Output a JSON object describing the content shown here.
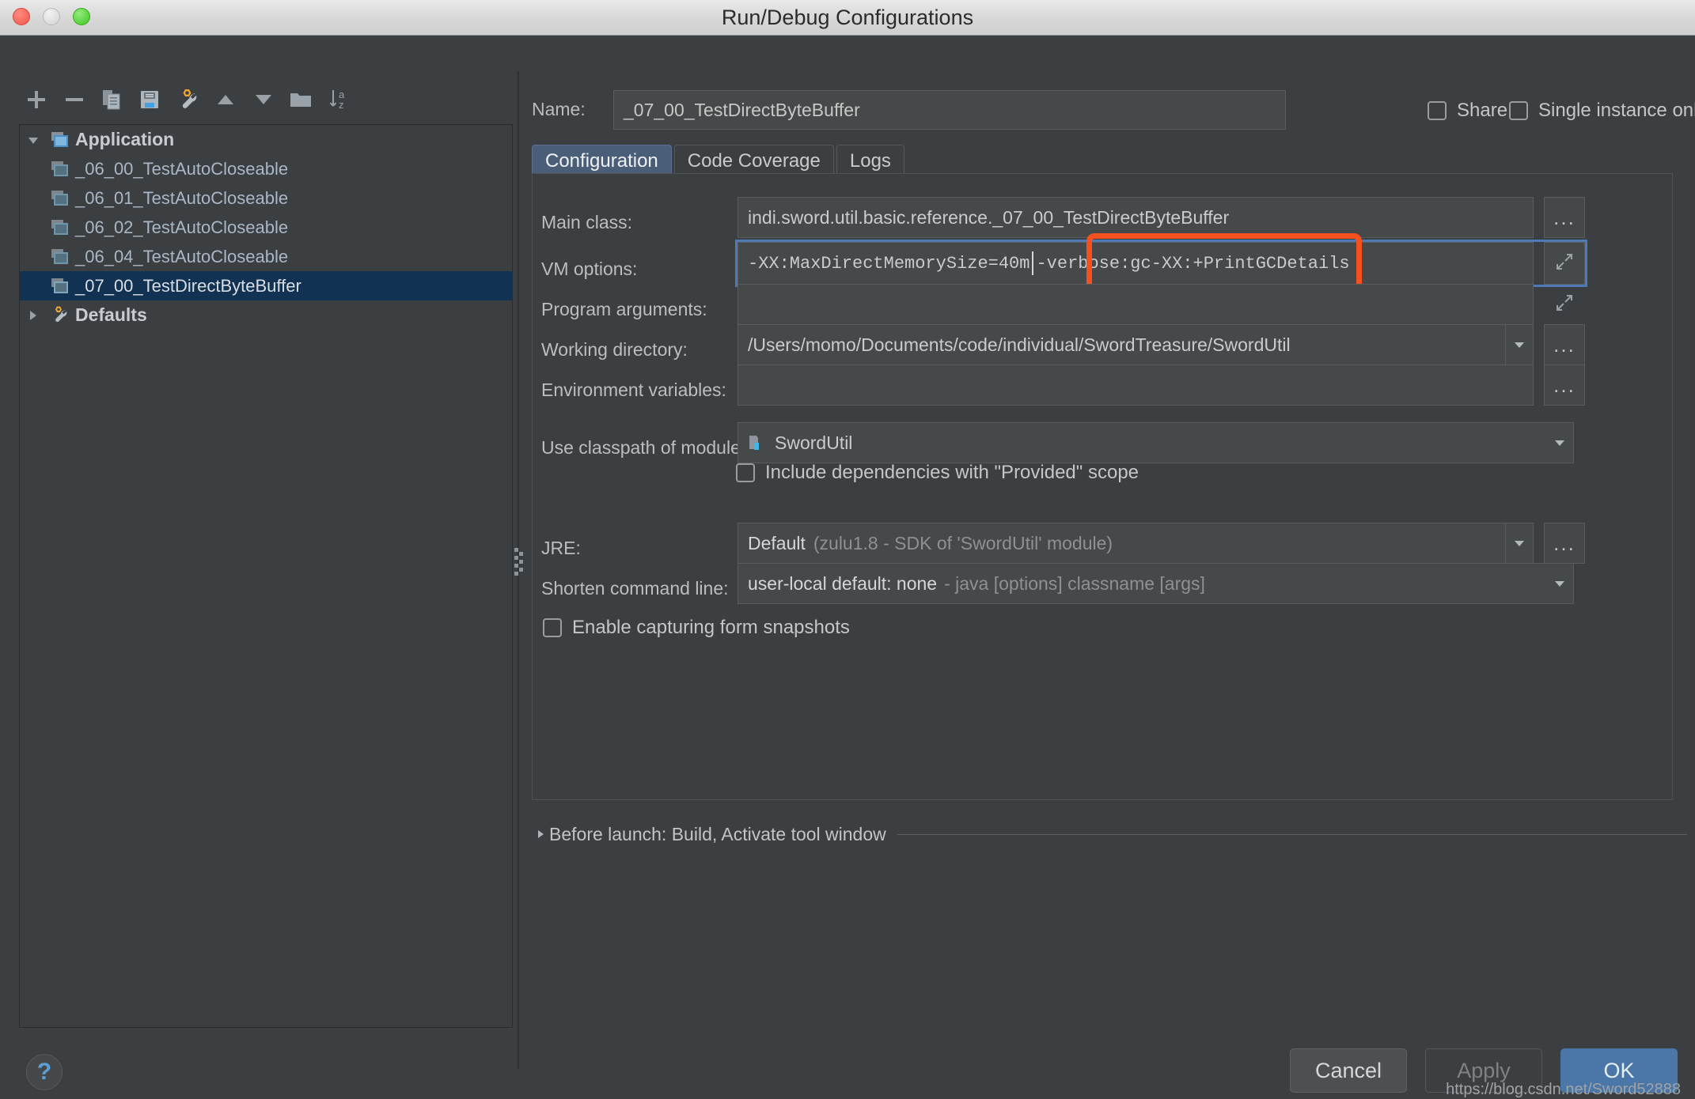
{
  "window": {
    "title": "Run/Debug Configurations",
    "traffic_lights": [
      "close",
      "minimize",
      "maximize"
    ]
  },
  "toolbar": {
    "items": [
      {
        "name": "add-icon",
        "glyph": "+"
      },
      {
        "name": "remove-icon",
        "glyph": "-"
      },
      {
        "name": "copy-icon",
        "glyph": "copy"
      },
      {
        "name": "save-icon",
        "glyph": "save"
      },
      {
        "name": "edit-defaults-icon",
        "glyph": "wrench"
      },
      {
        "name": "move-up-icon",
        "glyph": "triangle-up"
      },
      {
        "name": "move-down-icon",
        "glyph": "triangle-down"
      },
      {
        "name": "new-folder-icon",
        "glyph": "folder"
      },
      {
        "name": "sort-alphabetically-icon",
        "glyph": "sort-az"
      }
    ]
  },
  "tree": {
    "nodes": [
      {
        "label": "Application",
        "level": 0,
        "expanded": true,
        "selected": false,
        "icon": "application-icon"
      },
      {
        "label": "_06_00_TestAutoCloseable",
        "level": 1,
        "expanded": null,
        "selected": false,
        "icon": "run-config-icon"
      },
      {
        "label": "_06_01_TestAutoCloseable",
        "level": 1,
        "expanded": null,
        "selected": false,
        "icon": "run-config-icon"
      },
      {
        "label": "_06_02_TestAutoCloseable",
        "level": 1,
        "expanded": null,
        "selected": false,
        "icon": "run-config-icon"
      },
      {
        "label": "_06_04_TestAutoCloseable",
        "level": 1,
        "expanded": null,
        "selected": false,
        "icon": "run-config-icon"
      },
      {
        "label": "_07_00_TestDirectByteBuffer",
        "level": 1,
        "expanded": null,
        "selected": true,
        "icon": "run-config-icon"
      },
      {
        "label": "Defaults",
        "level": 0,
        "expanded": false,
        "selected": false,
        "icon": "defaults-wrench-icon"
      }
    ]
  },
  "form": {
    "name_label": "Name:",
    "name_value": "_07_00_TestDirectByteBuffer",
    "share_label": "Share",
    "share_checked": false,
    "single_instance_label": "Single instance only",
    "single_instance_checked": false,
    "tabs": [
      {
        "label": "Configuration",
        "active": true
      },
      {
        "label": "Code Coverage",
        "active": false
      },
      {
        "label": "Logs",
        "active": false
      }
    ],
    "main_class_label": "Main class:",
    "main_class_value": "indi.sword.util.basic.reference._07_00_TestDirectByteBuffer",
    "vm_options_label": "VM options:",
    "vm_options_value": "-XX:MaxDirectMemorySize=40m -verbose:gc -XX:+PrintGCDetails",
    "vm_options_part1": "-XX:MaxDirectMemorySize=40m ",
    "vm_options_part2": "-verbose:gc ",
    "vm_options_part3": "-XX:+PrintGCDetails",
    "program_arguments_label": "Program arguments:",
    "program_arguments_value": "",
    "working_directory_label": "Working directory:",
    "working_directory_value": "/Users/momo/Documents/code/individual/SwordTreasure/SwordUtil",
    "environment_variables_label": "Environment variables:",
    "environment_variables_value": "",
    "use_classpath_label": "Use classpath of module:",
    "use_classpath_value": "SwordUtil",
    "include_provided_label": "Include dependencies with \"Provided\" scope",
    "include_provided_checked": false,
    "jre_label": "JRE:",
    "jre_value": "Default",
    "jre_value_detail": "(zulu1.8 - SDK of 'SwordUtil' module)",
    "shorten_label": "Shorten command line:",
    "shorten_value": "user-local default: none",
    "shorten_value_detail": "- java [options] classname [args]",
    "enable_snapshots_label": "Enable capturing form snapshots",
    "enable_snapshots_checked": false,
    "dots_label": "...",
    "before_launch_label": "Before launch: Build, Activate tool window"
  },
  "footer": {
    "help_label": "?",
    "cancel_label": "Cancel",
    "apply_label": "Apply",
    "ok_label": "OK"
  },
  "watermark": "https://blog.csdn.net/Sword52888",
  "colors": {
    "background": "#3c3f41",
    "field_background": "#45494a",
    "selection_blue": "#123253",
    "accent_blue": "#4a76a8",
    "tab_active": "#4b5e78",
    "highlight_orange": "#f4511e",
    "focus_border": "#4e7ab5",
    "text": "#bdbdbd"
  }
}
